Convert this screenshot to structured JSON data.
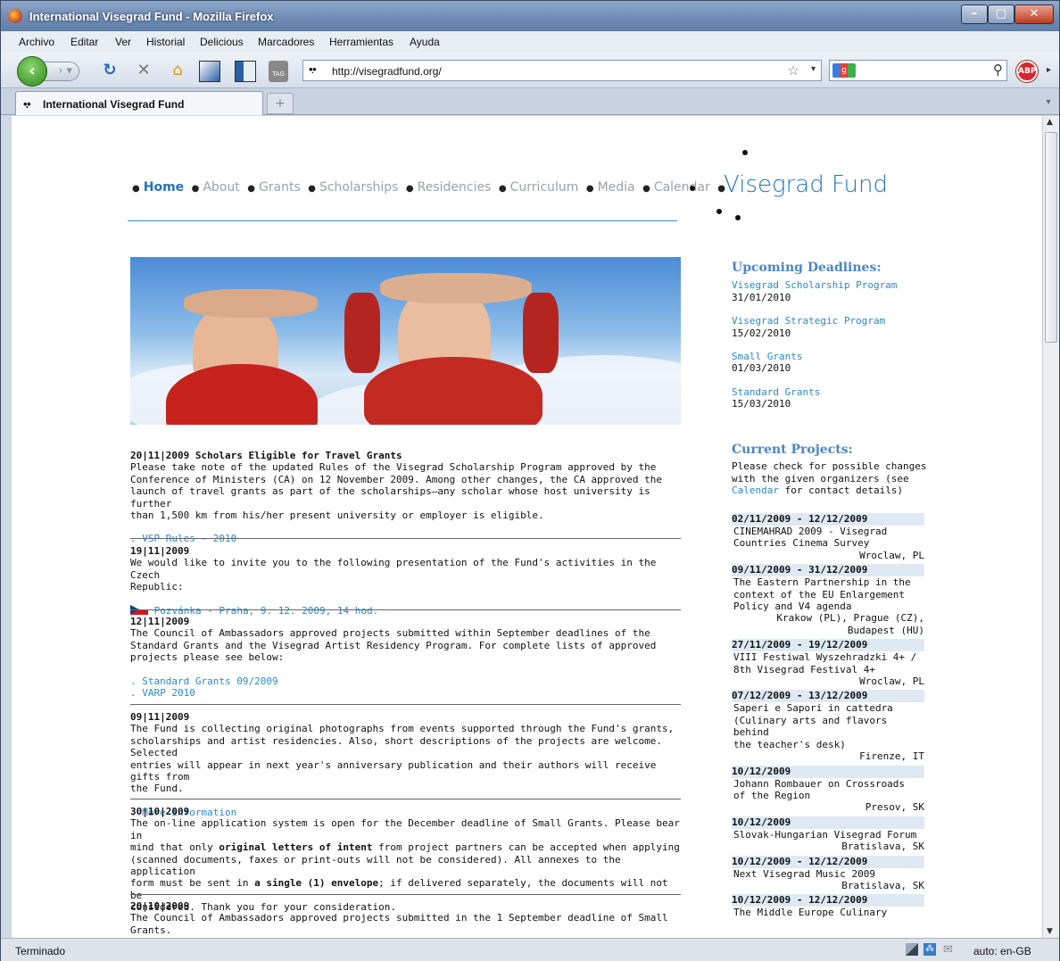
{
  "window": {
    "title": "International Visegrad Fund - Mozilla Firefox"
  },
  "menu": [
    "Archivo",
    "Editar",
    "Ver",
    "Historial",
    "Delicious",
    "Marcadores",
    "Herramientas",
    "Ayuda"
  ],
  "toolbar": {
    "url": "http://visegradfund.org/",
    "abp_label": "ABP",
    "tag_label": "TAG"
  },
  "tab": {
    "label": "International Visegrad Fund"
  },
  "status": {
    "text": "Terminado",
    "lang": "auto: en-GB"
  },
  "page": {
    "brand": "Visegrad Fund",
    "nav": [
      "Home",
      "About",
      "Grants",
      "Scholarships",
      "Residencies",
      "Curriculum",
      "Media",
      "Calendar"
    ],
    "news": [
      {
        "date": "20|11|2009 Scholars Eligible for Travel Grants",
        "lines": [
          "Please take note of the updated Rules of the Visegrad Scholarship Program approved by the",
          "Conference of Ministers (CA) on 12 November 2009. Among other changes, the CA approved the",
          "launch of travel grants as part of the scholarships—any scholar whose host university is further",
          "than 1,500 km from his/her present university or employer is eligible."
        ],
        "links": [
          ". VSP Rules - 2010"
        ]
      },
      {
        "date": "19|11|2009",
        "lines": [
          "We would like to invite you to the following presentation of the Fund's activities in the Czech",
          "Republic:"
        ],
        "links": [
          "Pozvánka - Praha, 9. 12. 2009, 14 hod."
        ]
      },
      {
        "date": "12|11|2009",
        "lines": [
          "The Council of Ambassadors approved projects submitted within September deadlines of the",
          "Standard Grants and the Visegrad Artist Residency Program. For complete lists of approved",
          "projects please see below:"
        ],
        "links": [
          ". Standard Grants 09/2009",
          ". VARP 2010"
        ]
      },
      {
        "date": "09|11|2009",
        "lines": [
          "The Fund is collecting original photographs from events supported through the Fund's grants,",
          "scholarships and artist residencies. Also, short descriptions of the projects are welcome. Selected",
          "entries will appear in next year's anniversary publication and their authors will receive gifts from",
          "the Fund."
        ],
        "links": [
          ". More information"
        ]
      },
      {
        "date": "30|10|2009",
        "rich": [
          [
            "The on-line application system is open for the December deadline of Small Grants. Please bear in"
          ],
          [
            "mind that only ",
            "original letters of intent",
            " from project partners can be accepted when applying"
          ],
          [
            "(scanned documents, faxes or print-outs will not be considered). All annexes to the application"
          ],
          [
            "form must be sent in ",
            "a single (1) envelope",
            "; if delivered separately, the documents will not be"
          ],
          [
            "considered. Thank you for your consideration."
          ]
        ]
      },
      {
        "date": "20|10|2009",
        "lines": [
          "The Council of Ambassadors approved projects submitted in the 1 September deadline of Small",
          "Grants."
        ]
      }
    ],
    "deadlines": {
      "title": "Upcoming Deadlines:",
      "items": [
        {
          "name": "Visegrad Scholarship Program",
          "date": "31/01/2010"
        },
        {
          "name": "Visegrad Strategic Program",
          "date": "15/02/2010"
        },
        {
          "name": "Small Grants",
          "date": "01/03/2010"
        },
        {
          "name": "Standard Grants",
          "date": "15/03/2010"
        }
      ]
    },
    "projects": {
      "title": "Current Projects:",
      "intro1": "Please check for possible changes",
      "intro2": "with the given organizers (see",
      "intro_link": "Calendar",
      "intro3": " for contact details)",
      "items": [
        {
          "dates": "02/11/2009 - 12/12/2009",
          "title": [
            "CINEMAHRAD 2009 - Visegrad",
            "Countries Cinema Survey"
          ],
          "place": [
            "Wroclaw, PL"
          ]
        },
        {
          "dates": "09/11/2009 - 31/12/2009",
          "title": [
            "The Eastern Partnership in the",
            "context of the EU Enlargement",
            "Policy and V4 agenda"
          ],
          "place": [
            "Krakow (PL), Prague (CZ),",
            "Budapest (HU)"
          ]
        },
        {
          "dates": "27/11/2009 - 19/12/2009",
          "title": [
            "VIII Festiwal Wyszehradzki 4+ /",
            "8th Visegrad Festival 4+"
          ],
          "place": [
            "Wroclaw, PL"
          ]
        },
        {
          "dates": "07/12/2009 - 13/12/2009",
          "title": [
            "Saperi e Sapori in cattedra",
            "(Culinary arts and flavors behind",
            "the teacher's desk)"
          ],
          "place": [
            "Firenze, IT"
          ]
        },
        {
          "dates": "10/12/2009",
          "title": [
            "Johann Rombauer on Crossroads",
            "of the Region"
          ],
          "place": [
            "Presov, SK"
          ]
        },
        {
          "dates": "10/12/2009",
          "title": [
            "Slovak-Hungarian Visegrad Forum"
          ],
          "place": [
            "Bratislava, SK"
          ]
        },
        {
          "dates": "10/12/2009 - 12/12/2009",
          "title": [
            "Next Visegrad Music 2009"
          ],
          "place": [
            "Bratislava, SK"
          ]
        },
        {
          "dates": "10/12/2009 - 12/12/2009",
          "title": [
            "The Middle Europe Culinary"
          ],
          "place": []
        }
      ]
    }
  }
}
